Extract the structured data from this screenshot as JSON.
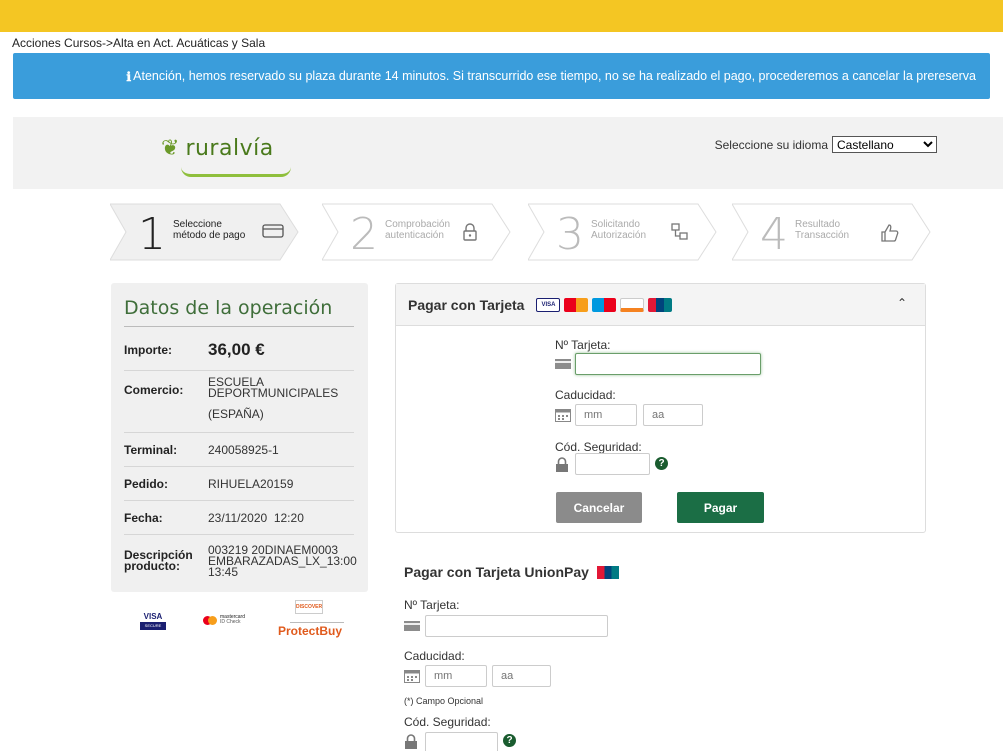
{
  "breadcrumb": "Acciones Cursos->Alta en Act. Acuáticas y Sala",
  "alert": {
    "icon": "info-icon",
    "text": "Atención, hemos reservado su plaza durante 14 minutos. Si transcurrido ese tiempo, no se ha realizado el pago, procederemos a cancelar la prereserva"
  },
  "header": {
    "brand": "ruralvía",
    "language_label": "Seleccione su idioma",
    "language_selected": "Castellano"
  },
  "steps": [
    {
      "number": "1",
      "line1": "Seleccione",
      "line2": "método de pago",
      "icon": "card-icon",
      "active": true
    },
    {
      "number": "2",
      "line1": "Comprobación",
      "line2": "autenticación",
      "icon": "lock-icon",
      "active": false
    },
    {
      "number": "3",
      "line1": "Solicitando",
      "line2": "Autorización",
      "icon": "network-icon",
      "active": false
    },
    {
      "number": "4",
      "line1": "Resultado",
      "line2": "Transacción",
      "icon": "thumbs-up-icon",
      "active": false
    }
  ],
  "operation": {
    "title": "Datos de la operación",
    "rows": [
      {
        "label": "Importe:",
        "value": "36,00 €"
      },
      {
        "label": "Comercio:",
        "value": "ESCUELA DEPORTMUNICIPALES",
        "value2": "(ESPAÑA)"
      },
      {
        "label": "Terminal:",
        "value": "240058925-1"
      },
      {
        "label": "Pedido:",
        "value": "RIHUELA20159"
      },
      {
        "label": "Fecha:",
        "value": "23/11/2020  12:20"
      },
      {
        "label": "Descripción producto:",
        "value": "003219 20DINAEM0003 EMBARAZADAS_LX_13:00 13:45"
      }
    ]
  },
  "security_logos": {
    "visa": "VISA",
    "visa_sub": "SECURE",
    "mastercard": "mastercard",
    "mastercard_sub": "ID Check",
    "discover": "DISCOVER",
    "protectbuy": "ProtectBuy"
  },
  "card_panel": {
    "title": "Pagar con Tarjeta",
    "card_label": "Nº Tarjeta:",
    "expiry_label": "Caducidad:",
    "mm_placeholder": "mm",
    "yy_placeholder": "aa",
    "cvv_label": "Cód. Seguridad:",
    "cancel": "Cancelar",
    "pay": "Pagar"
  },
  "unionpay": {
    "title": "Pagar con Tarjeta UnionPay",
    "card_label": "Nº Tarjeta:",
    "expiry_label": "Caducidad:",
    "mm_placeholder": "mm",
    "yy_placeholder": "aa",
    "optional_note": "(*) Campo Opcional",
    "cvv_label": "Cód. Seguridad:"
  },
  "colors": {
    "topbar": "#f4c623",
    "alert": "#3a9ddb",
    "brand_green": "#3f6e3a",
    "pay_button": "#1b6e45",
    "cancel_button": "#8b8b8b"
  }
}
